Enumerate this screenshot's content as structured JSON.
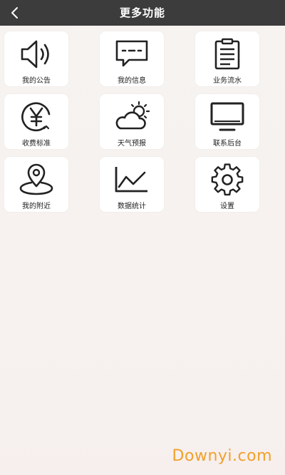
{
  "header": {
    "title": "更多功能",
    "back_icon": "chevron-left-icon"
  },
  "tiles": [
    {
      "label": "我的公告",
      "icon": "speaker-icon"
    },
    {
      "label": "我的信息",
      "icon": "message-icon"
    },
    {
      "label": "业务流水",
      "icon": "clipboard-icon"
    },
    {
      "label": "收费标准",
      "icon": "yen-icon"
    },
    {
      "label": "天气预报",
      "icon": "weather-icon"
    },
    {
      "label": "联系后台",
      "icon": "monitor-icon"
    },
    {
      "label": "我的附近",
      "icon": "location-pin-icon"
    },
    {
      "label": "数据统计",
      "icon": "line-chart-icon"
    },
    {
      "label": "设置",
      "icon": "gear-icon"
    }
  ],
  "watermark": "Downyi.com",
  "colors": {
    "header_bg": "#3c3c3c",
    "watermark": "#f1a12a"
  }
}
